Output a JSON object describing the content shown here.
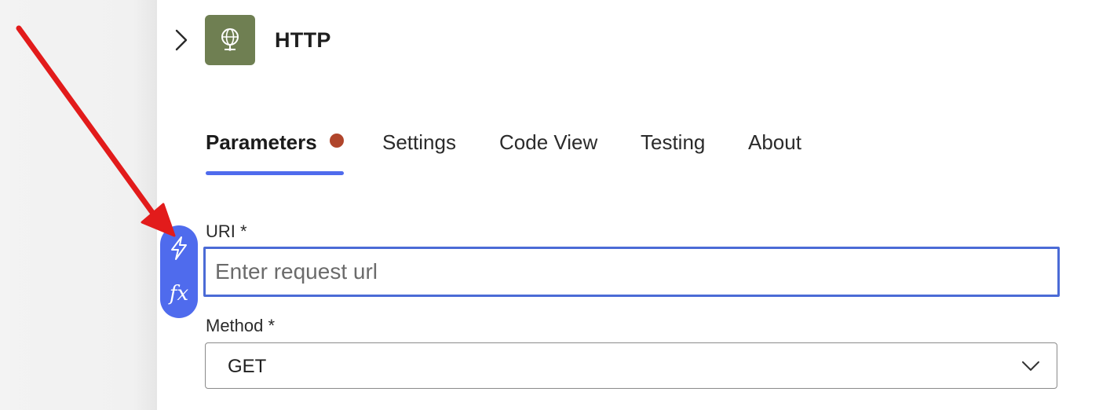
{
  "action": {
    "title": "HTTP",
    "icon": "globe-icon",
    "icon_bg_color": "#6f7f52"
  },
  "tabs": [
    {
      "label": "Parameters",
      "active": true,
      "has_error_dot": true
    },
    {
      "label": "Settings",
      "active": false
    },
    {
      "label": "Code View",
      "active": false
    },
    {
      "label": "Testing",
      "active": false
    },
    {
      "label": "About",
      "active": false
    }
  ],
  "fields": {
    "uri": {
      "label": "URI *",
      "value": "",
      "placeholder": "Enter request url"
    },
    "method": {
      "label": "Method *",
      "value": "GET"
    }
  },
  "token_picker": {
    "dynamic_content_icon": "lightning-icon",
    "expression_icon": "fx-icon",
    "expression_glyph": "fx"
  },
  "colors": {
    "accent": "#4f6bed",
    "error_dot": "#b0452b",
    "annotation_arrow": "#e21b1b"
  }
}
